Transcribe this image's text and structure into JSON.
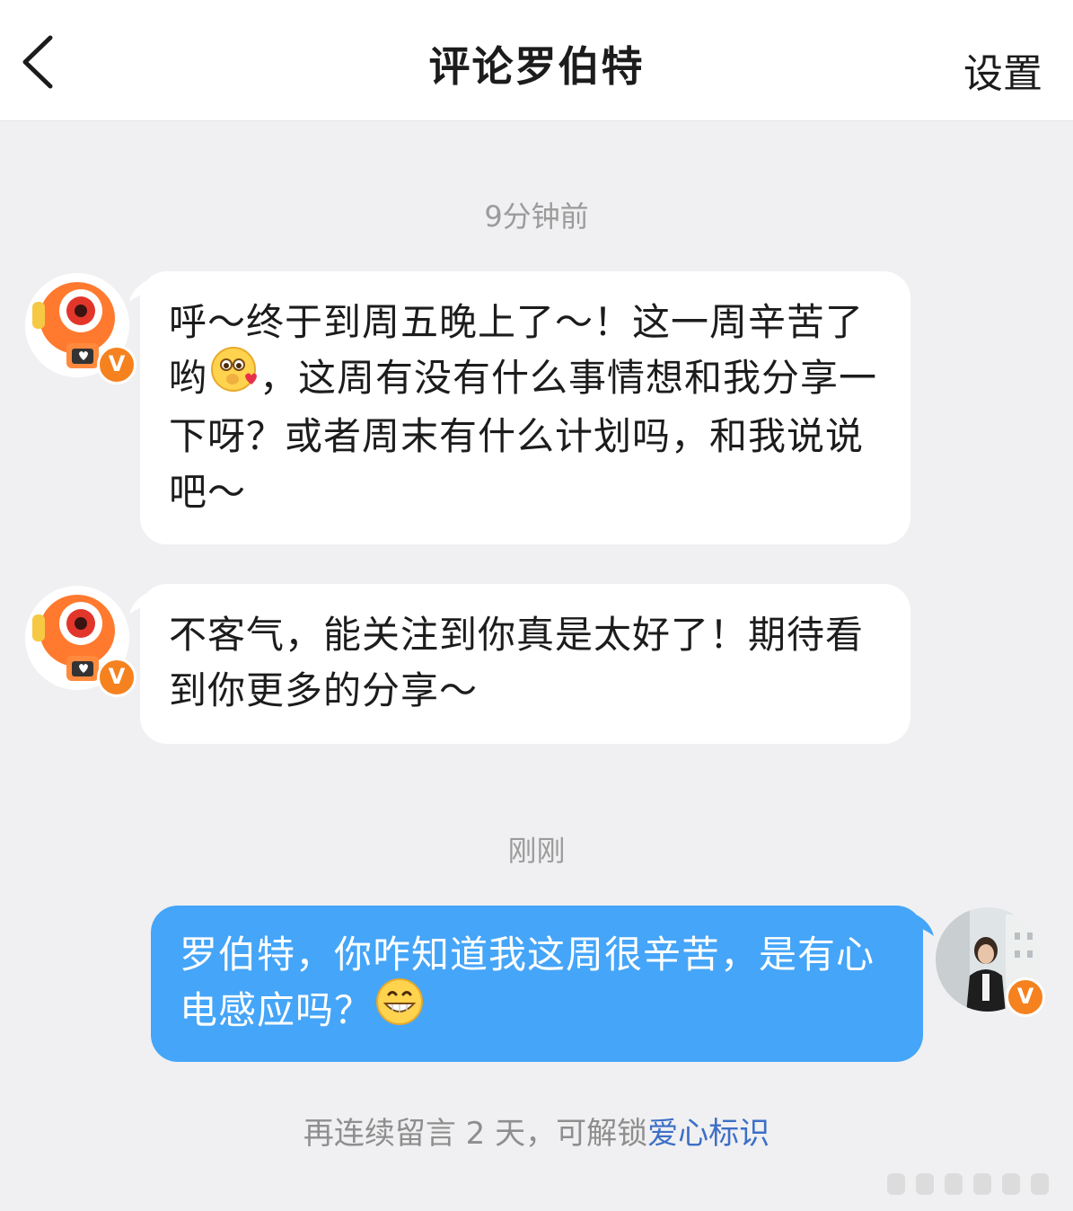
{
  "header": {
    "title": "评论罗伯特",
    "settings_label": "设置",
    "back_icon": "chevron-left-icon"
  },
  "conversation": [
    {
      "type": "time",
      "text": "9分钟前"
    },
    {
      "type": "message",
      "sender": "bot",
      "text_parts": [
        "呼～终于到周五晚上了～！这一周辛苦了哟",
        "，这周有没有什么事情想和我分享一下呀？或者周末有什么计划吗，和我说说吧～"
      ],
      "emoji": "shy-love-face-emoji"
    },
    {
      "type": "message",
      "sender": "bot",
      "text": "不客气，能关注到你真是太好了！期待看到你更多的分享～"
    },
    {
      "type": "time",
      "text": "刚刚"
    },
    {
      "type": "message",
      "sender": "user",
      "text": "罗伯特，你咋知道我这周很辛苦，是有心电感应吗？",
      "emoji": "grinning-face-emoji"
    }
  ],
  "footer": {
    "hint_prefix": "再连续留言 2 天，可解锁",
    "hint_link": "爱心标识"
  },
  "badges": {
    "verified": "V"
  },
  "colors": {
    "background": "#f0f0f2",
    "bot_bubble": "#ffffff",
    "user_bubble": "#45a5f8",
    "verified_badge": "#f5821f",
    "link": "#3d6fc7"
  }
}
